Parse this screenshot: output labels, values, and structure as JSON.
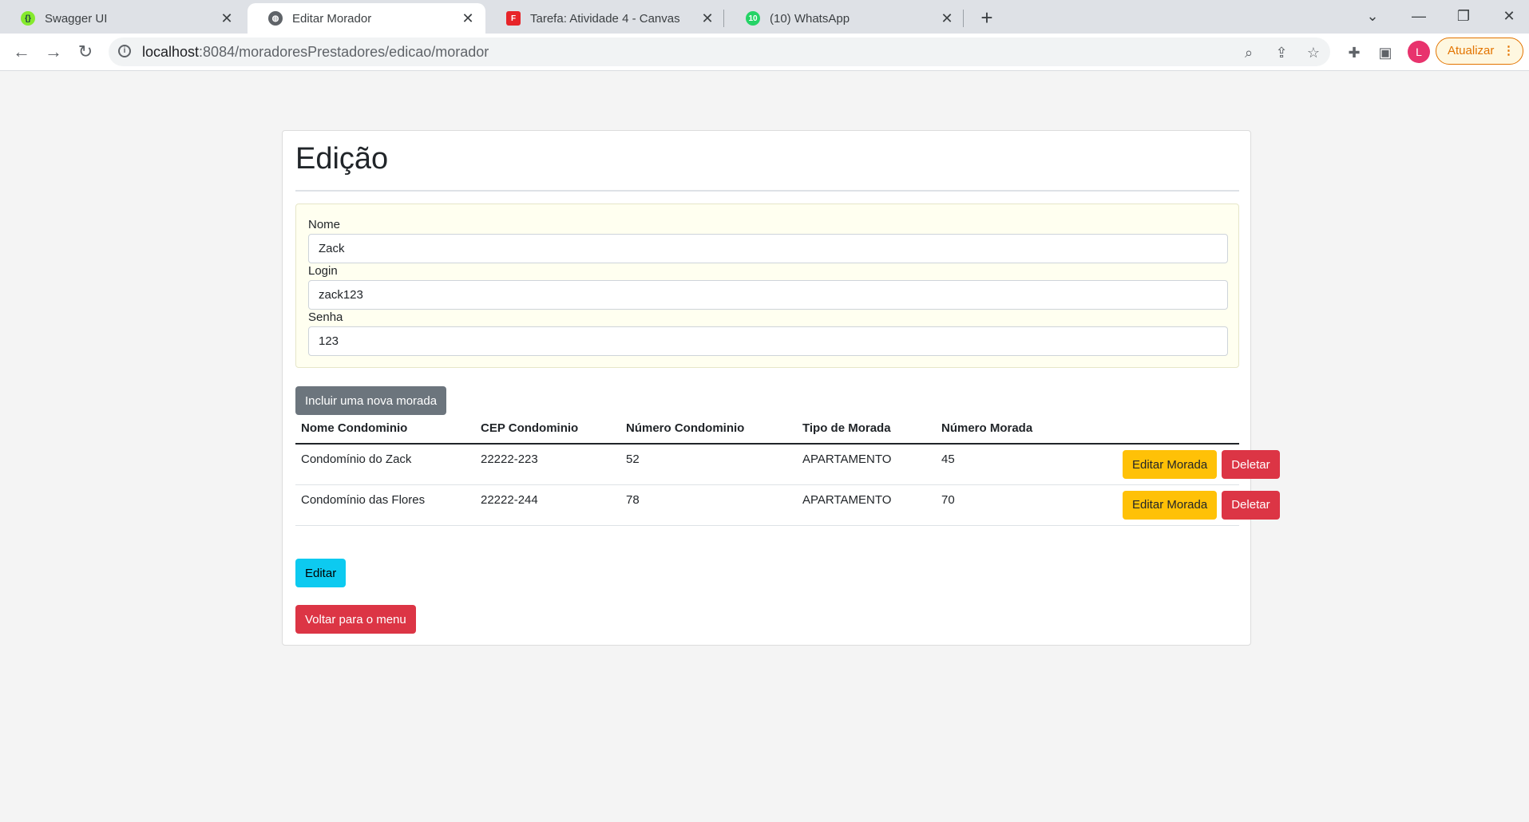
{
  "browser": {
    "tabs": [
      {
        "title": "Swagger UI",
        "favicon": "swagger-icon",
        "favicon_color": "#85ea2d"
      },
      {
        "title": "Editar Morador",
        "favicon": "globe-icon",
        "active": true
      },
      {
        "title": "Tarefa: Atividade 4 - Canvas",
        "favicon": "canvas-icon",
        "favicon_color": "#e72429"
      },
      {
        "title": "(10) WhatsApp",
        "favicon": "whatsapp-icon",
        "favicon_color": "#25d366",
        "badge": "10"
      }
    ],
    "url_host": "localhost",
    "url_rest": ":8084/moradoresPrestadores/edicao/morador",
    "profile_initial": "L",
    "update_label": "Atualizar"
  },
  "page": {
    "title": "Edição",
    "form": {
      "nome_label": "Nome",
      "nome_value": "Zack",
      "login_label": "Login",
      "login_value": "zack123",
      "senha_label": "Senha",
      "senha_value": "123"
    },
    "add_button": "Incluir uma nova morada",
    "table": {
      "headers": [
        "Nome Condominio",
        "CEP Condominio",
        "Número Condominio",
        "Tipo de Morada",
        "Número Morada",
        ""
      ],
      "rows": [
        {
          "nome": "Condomínio do Zack",
          "cep": "22222-223",
          "numero_condominio": "52",
          "tipo": "APARTAMENTO",
          "numero_morada": "45",
          "edit_label": "Editar Morada",
          "delete_label": "Deletar"
        },
        {
          "nome": "Condomínio das Flores",
          "cep": "22222-244",
          "numero_condominio": "78",
          "tipo": "APARTAMENTO",
          "numero_morada": "70",
          "edit_label": "Editar Morada",
          "delete_label": "Deletar"
        }
      ]
    },
    "edit_button": "Editar",
    "back_button": "Voltar para o menu"
  },
  "colors": {
    "primary_secondary": "#6c757d",
    "warning": "#ffc107",
    "danger": "#dc3545",
    "info": "#0dcaf0",
    "form_background": "#fffff0"
  }
}
